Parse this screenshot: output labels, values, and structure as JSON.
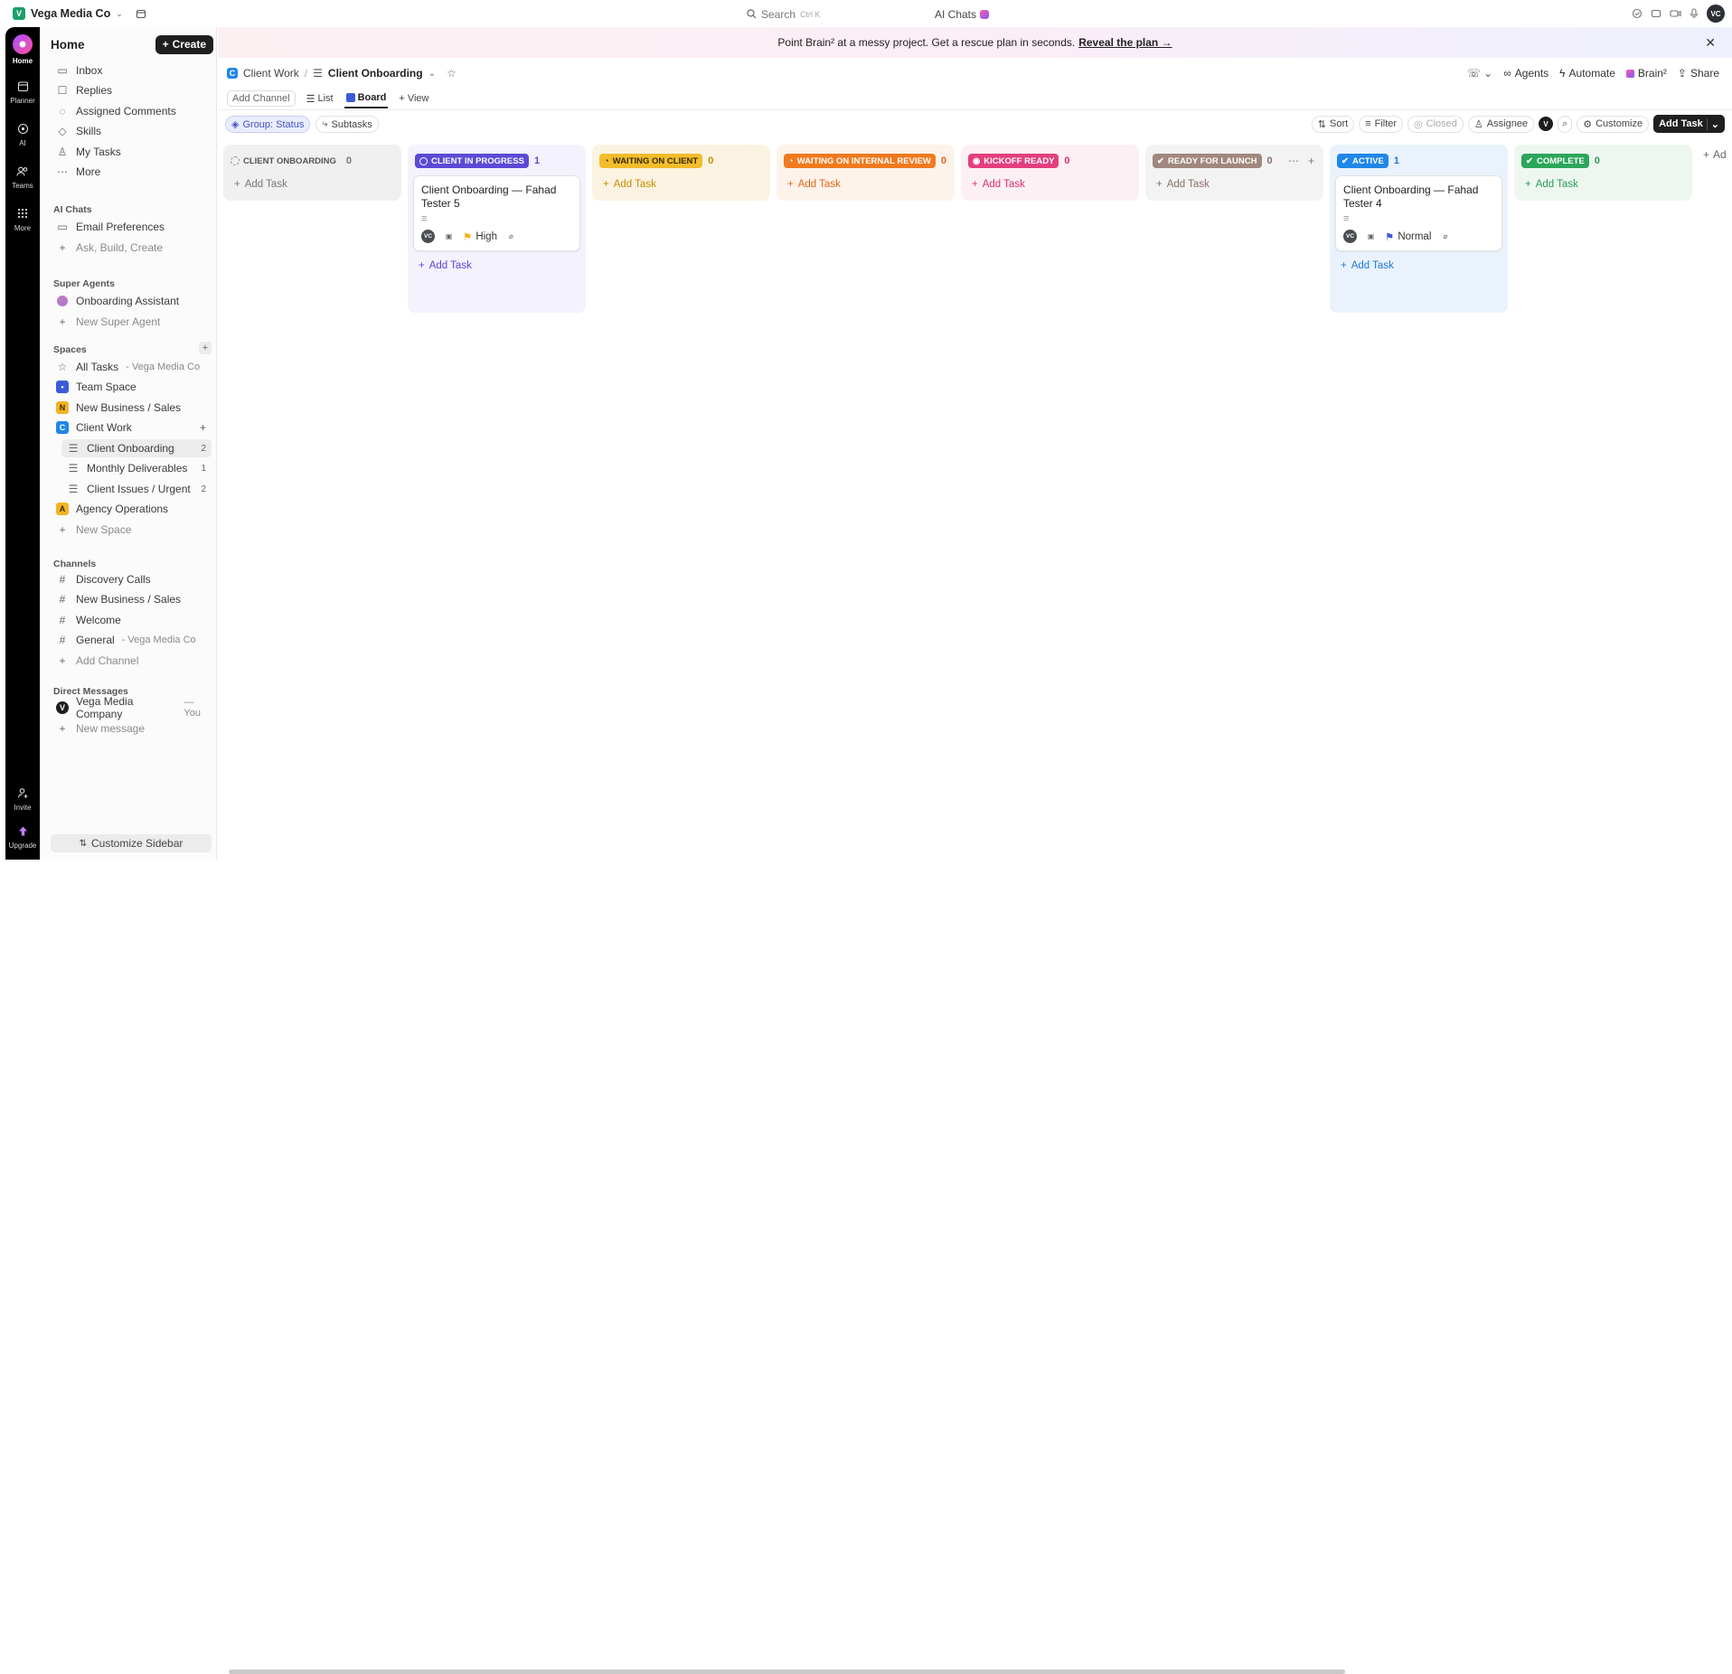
{
  "topbar": {
    "workspace_initial": "V",
    "workspace_name": "Vega Media Co",
    "search_placeholder": "Search",
    "search_shortcut": "Ctrl K",
    "ai_chats": "AI Chats",
    "user_initials": "VC"
  },
  "rail": {
    "home": "Home",
    "planner": "Planner",
    "ai": "AI",
    "teams": "Teams",
    "more": "More",
    "invite": "Invite",
    "upgrade": "Upgrade"
  },
  "sidebar": {
    "title": "Home",
    "create": "Create",
    "nav": [
      "Inbox",
      "Replies",
      "Assigned Comments",
      "Skills",
      "My Tasks",
      "More"
    ],
    "ai_chats_section": "AI Chats",
    "ai_chats": [
      "Email Preferences",
      "Ask, Build, Create"
    ],
    "super_agents_section": "Super Agents",
    "super_agents": [
      "Onboarding Assistant",
      "New Super Agent"
    ],
    "spaces_section": "Spaces",
    "all_tasks": "All Tasks",
    "all_tasks_suffix": "- Vega Media Co",
    "spaces": [
      {
        "initial": "",
        "label": "Team Space"
      },
      {
        "initial": "N",
        "label": "New Business / Sales"
      },
      {
        "initial": "C",
        "label": "Client Work"
      }
    ],
    "lists": [
      {
        "label": "Client Onboarding",
        "count": "2"
      },
      {
        "label": "Monthly Deliverables",
        "count": "1"
      },
      {
        "label": "Client Issues / Urgent",
        "count": "2"
      }
    ],
    "agency_initial": "A",
    "agency": "Agency Operations",
    "new_space": "New Space",
    "channels_section": "Channels",
    "channels": [
      "Discovery Calls",
      "New Business / Sales",
      "Welcome"
    ],
    "general": "General",
    "general_suffix": "- Vega Media Co",
    "add_channel": "Add Channel",
    "dm_section": "Direct Messages",
    "dm_initial": "V",
    "dm_name": "Vega Media Company",
    "dm_suffix": "— You",
    "new_message": "New message",
    "customize": "Customize Sidebar"
  },
  "banner": {
    "text": "Point Brain² at a messy project. Get a rescue plan in seconds.",
    "link": "Reveal the plan →"
  },
  "header": {
    "space_initial": "C",
    "space": "Client Work",
    "list": "Client Onboarding",
    "agents": "Agents",
    "automate": "Automate",
    "brain": "Brain²",
    "share": "Share"
  },
  "tabs": {
    "add_channel": "Add Channel",
    "list": "List",
    "board": "Board",
    "view": "View"
  },
  "toolbar": {
    "group": "Group: Status",
    "subtasks": "Subtasks",
    "sort": "Sort",
    "filter": "Filter",
    "closed": "Closed",
    "assignee": "Assignee",
    "assignee_initial": "V",
    "customize": "Customize",
    "add_task": "Add Task"
  },
  "columns": [
    {
      "label": "Client Onboarding",
      "count": "0",
      "add": "Add Task",
      "bg": "#f0f0f0",
      "pill_bg": "#e4e4e4",
      "pill_fg": "#555555",
      "accent": "#777777"
    },
    {
      "label": "Client in Progress",
      "count": "1",
      "add": "Add Task",
      "bg": "#f3f2fd",
      "pill_bg": "#5b4ad6",
      "pill_fg": "#ffffff",
      "accent": "#5b4ad6"
    },
    {
      "label": "Waiting on Client",
      "count": "0",
      "add": "Add Task",
      "bg": "#fbf3e1",
      "pill_bg": "#f2bd2c",
      "pill_fg": "#3a2a00",
      "accent": "#c58a00"
    },
    {
      "label": "Waiting on Internal Review",
      "count": "0",
      "add": "Add Task",
      "bg": "#fdf3ea",
      "pill_bg": "#f07a1f",
      "pill_fg": "#ffffff",
      "accent": "#e0661a"
    },
    {
      "label": "Kickoff Ready",
      "count": "0",
      "add": "Add Task",
      "bg": "#fdf0f4",
      "pill_bg": "#e33f7e",
      "pill_fg": "#ffffff",
      "accent": "#d92f6f"
    },
    {
      "label": "Ready for Launch",
      "count": "0",
      "add": "Add Task",
      "bg": "#f3f3f3",
      "pill_bg": "#a1887f",
      "pill_fg": "#ffffff",
      "accent": "#8a7068"
    },
    {
      "label": "Active",
      "count": "1",
      "add": "Add Task",
      "bg": "#eaf3fd",
      "pill_bg": "#1f87e8",
      "pill_fg": "#ffffff",
      "accent": "#1a7ad8"
    },
    {
      "label": "Complete",
      "count": "0",
      "add": "Add Task",
      "bg": "#edf7f0",
      "pill_bg": "#2ca65a",
      "pill_fg": "#ffffff",
      "accent": "#2a9a55"
    }
  ],
  "cards": [
    {
      "title": "Client Onboarding — Fahad Tester 5",
      "assignee": "VC",
      "priority": "High",
      "priority_color": "#f2b31e"
    },
    {
      "title": "Client Onboarding — Fahad Tester 4",
      "assignee": "VC",
      "priority": "Normal",
      "priority_color": "#3f5bd8"
    }
  ],
  "add_column": "Ad"
}
